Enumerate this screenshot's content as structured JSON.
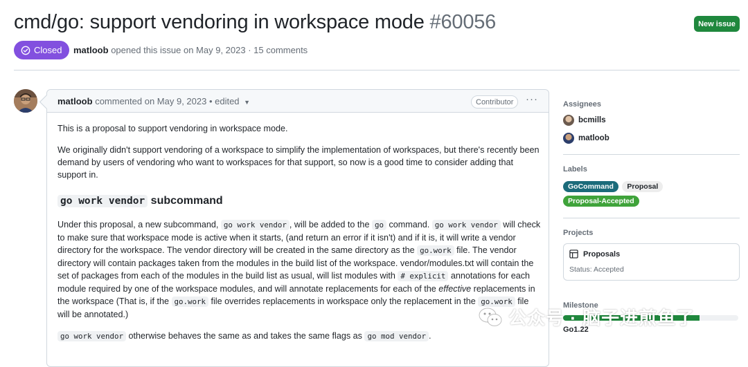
{
  "issue": {
    "title": "cmd/go: support vendoring in workspace mode",
    "number": "#60056",
    "state": "Closed",
    "author": "matloob",
    "opened_text": "opened this issue on May 9, 2023 · 15 comments",
    "new_issue_label": "New issue"
  },
  "comment": {
    "author": "matloob",
    "meta": "commented on May 9, 2023 • edited",
    "role": "Contributor",
    "menu": "···",
    "p1": "This is a proposal to support vendoring in workspace mode.",
    "p2": "We originally didn't support vendoring of a workspace to simplify the implementation of workspaces, but there's recently been demand by users of vendoring who want to workspaces for that support, so now is a good time to consider adding that support in.",
    "h_code": "go work vendor",
    "h_text": " subcommand",
    "p3_a": "Under this proposal, a new subcommand, ",
    "p3_code1": "go work vendor",
    "p3_b": ", will be added to the ",
    "p3_code2": "go",
    "p3_c": " command. ",
    "p3_code3": "go work vendor",
    "p3_d": " will check to make sure that workspace mode is active when it starts, (and return an error if it isn't) and if it is, it will write a vendor directory for the workspace. The vendor directory will be created in the same directory as the ",
    "p3_code4": "go.work",
    "p3_e": " file. The vendor directory will contain packages taken from the modules in the build list of the workspace. vendor/modules.txt will contain the set of packages from each of the modules in the build list as usual, will list modules with ",
    "p3_code5": "# explicit",
    "p3_f": " annotations for each module required by one of the workspace modules, and will annotate replacements for each of the ",
    "p3_em": "effective",
    "p3_g": " replacements in the workspace (That is, if the ",
    "p3_code6": "go.work",
    "p3_h": " file overrides replacements in workspace only the replacement in the ",
    "p3_code7": "go.work",
    "p3_i": " file will be annotated.)",
    "p4_code1": "go work vendor",
    "p4_a": " otherwise behaves the same as and takes the same flags as ",
    "p4_code2": "go mod vendor",
    "p4_b": "."
  },
  "sidebar": {
    "assignees_heading": "Assignees",
    "assignees": [
      "bcmills",
      "matloob"
    ],
    "labels_heading": "Labels",
    "labels": [
      {
        "name": "GoCommand",
        "bg": "#1b6b7a",
        "fg": "#ffffff"
      },
      {
        "name": "Proposal",
        "bg": "#ededed",
        "fg": "#1f2328"
      },
      {
        "name": "Proposal-Accepted",
        "bg": "#3fa33a",
        "fg": "#ffffff"
      }
    ],
    "projects_heading": "Projects",
    "project_name": "Proposals",
    "project_status": "Status: Accepted",
    "milestone_heading": "Milestone",
    "milestone_progress": 0.78,
    "milestone_name": "Go1.22"
  },
  "watermark": {
    "text": "公众号 · 脑子进煎鱼了"
  },
  "colors": {
    "closed": "#8250df",
    "new_issue": "#1f883d",
    "border": "#d0d7de"
  }
}
